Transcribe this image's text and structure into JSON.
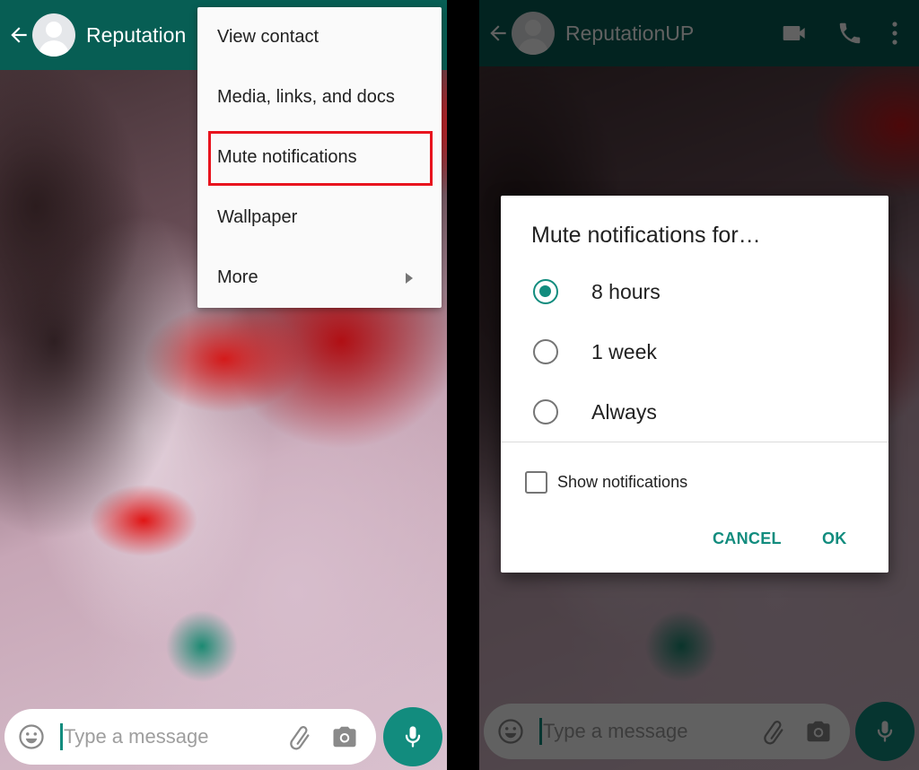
{
  "colors": {
    "appbar": "#075E54",
    "accent": "#128C7E",
    "highlight": "#e8141e"
  },
  "left_screen": {
    "appbar": {
      "back_icon": "arrow-left-icon",
      "title": "Reputation"
    },
    "overflow_menu": {
      "items": [
        {
          "label": "View contact"
        },
        {
          "label": "Media, links, and docs"
        },
        {
          "label": "Mute notifications",
          "highlighted": true
        },
        {
          "label": "Wallpaper"
        },
        {
          "label": "More",
          "has_submenu": true
        }
      ]
    },
    "input_bar": {
      "placeholder": "Type a message",
      "emoji_icon": "emoji-icon",
      "attach_icon": "paperclip-icon",
      "camera_icon": "camera-icon",
      "mic_icon": "microphone-icon"
    }
  },
  "right_screen": {
    "appbar": {
      "back_icon": "arrow-left-icon",
      "title": "ReputationUP",
      "video_icon": "video-camera-icon",
      "call_icon": "phone-icon",
      "menu_icon": "more-vertical-icon"
    },
    "dialog": {
      "title": "Mute notifications for…",
      "options": [
        {
          "label": "8 hours",
          "selected": true
        },
        {
          "label": "1 week",
          "selected": false
        },
        {
          "label": "Always",
          "selected": false
        }
      ],
      "show_notifications": {
        "label": "Show notifications",
        "checked": false
      },
      "cancel_label": "CANCEL",
      "ok_label": "OK"
    },
    "input_bar": {
      "placeholder": "Type a message"
    }
  }
}
